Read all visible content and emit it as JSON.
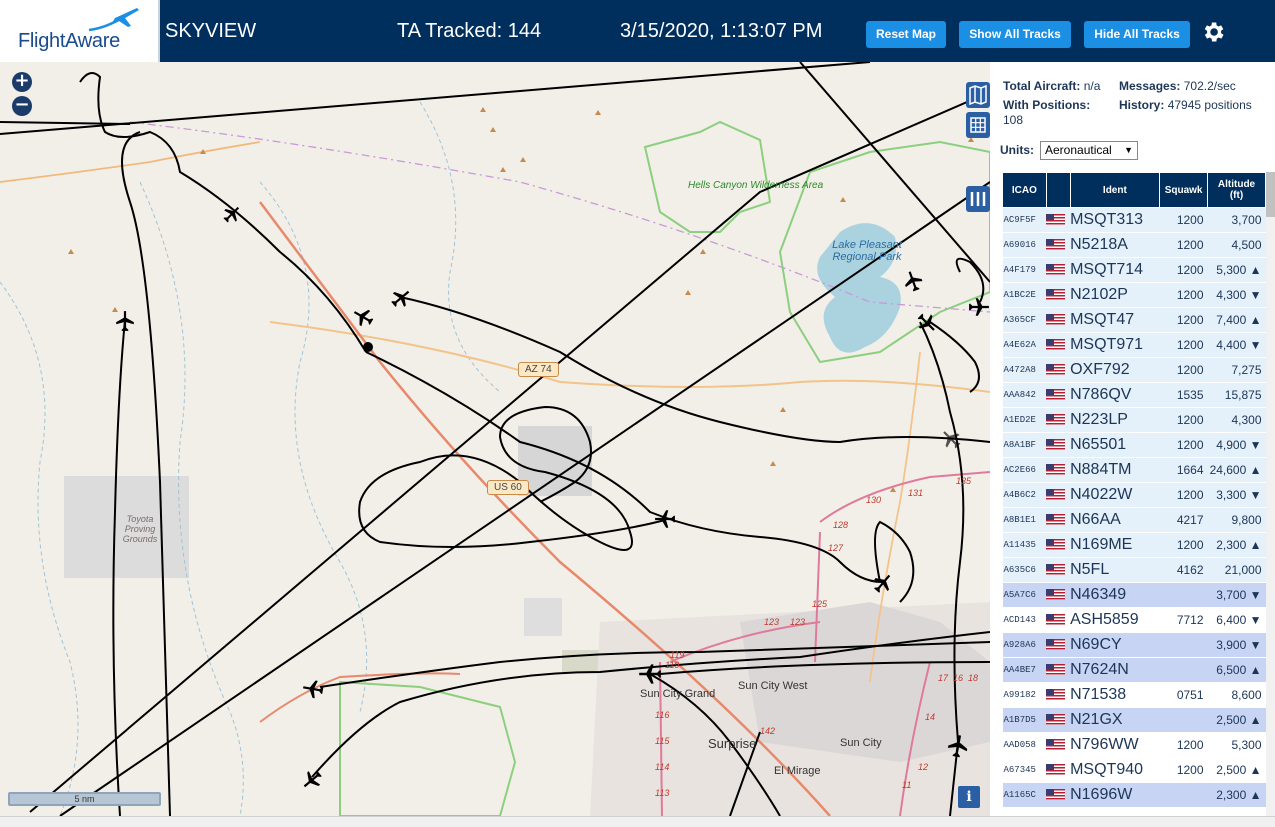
{
  "header": {
    "logo_text": "FlightAware",
    "app_title": "SKYVIEW",
    "tracked": "TA Tracked: 144",
    "datetime": "3/15/2020, 1:13:07 PM",
    "buttons": {
      "reset_map": "Reset Map",
      "show_all": "Show All Tracks",
      "hide_all": "Hide All Tracks"
    },
    "settings_icon": "gear-icon"
  },
  "colors": {
    "header_bg": "#002f5d",
    "button_bg": "#1a8fe3",
    "row_alt": "#e4f0fa",
    "row_selected": "#c8d4f4"
  },
  "map": {
    "zoom_in": "+",
    "zoom_out": "−",
    "scale_label": "5 nm",
    "info": "i",
    "labels": {
      "hells_canyon": "Hells Canyon Wilderness Area",
      "lake_pleasant": "Lake Pleasant Regional Park",
      "toyota": "Toyota Proving Grounds",
      "az74": "AZ 74",
      "us60": "US 60",
      "sun_city_grand": "Sun City Grand",
      "sun_city_west": "Sun City West",
      "surprise": "Surprise",
      "sun_city": "Sun City",
      "el_mirage": "El Mirage"
    },
    "road_numbers": [
      "130",
      "131",
      "135",
      "128",
      "127",
      "125",
      "123",
      "123",
      "119",
      "119",
      "142",
      "116",
      "115",
      "114",
      "113",
      "17",
      "16",
      "18",
      "14",
      "12",
      "11"
    ]
  },
  "sidebar": {
    "total_aircraft_label": "Total Aircraft:",
    "total_aircraft_value": "n/a",
    "messages_label": "Messages:",
    "messages_value": "702.2/sec",
    "with_positions_label": "With Positions:",
    "with_positions_value": "108",
    "history_label": "History:",
    "history_value": "47945 positions",
    "units_label": "Units:",
    "units_value": "Aeronautical",
    "columns": {
      "icao": "ICAO",
      "ident": "Ident",
      "squawk": "Squawk",
      "altitude": "Altitude (ft)"
    },
    "rows": [
      {
        "icao": "AC9F5F",
        "ident": "MSQT313",
        "squawk": "1200",
        "alt": "3,700",
        "style": "row-a"
      },
      {
        "icao": "A69016",
        "ident": "N5218A",
        "squawk": "1200",
        "alt": "4,500",
        "style": "row-a"
      },
      {
        "icao": "A4F179",
        "ident": "MSQT714",
        "squawk": "1200",
        "alt": "5,300 ▲",
        "style": "row-a"
      },
      {
        "icao": "A1BC2E",
        "ident": "N2102P",
        "squawk": "1200",
        "alt": "4,300 ▼",
        "style": "row-a"
      },
      {
        "icao": "A365CF",
        "ident": "MSQT47",
        "squawk": "1200",
        "alt": "7,400 ▲",
        "style": "row-a"
      },
      {
        "icao": "A4E62A",
        "ident": "MSQT971",
        "squawk": "1200",
        "alt": "4,400 ▼",
        "style": "row-a"
      },
      {
        "icao": "A472A8",
        "ident": "OXF792",
        "squawk": "1200",
        "alt": "7,275",
        "style": "row-a"
      },
      {
        "icao": "AAA842",
        "ident": "N786QV",
        "squawk": "1535",
        "alt": "15,875",
        "style": "row-a"
      },
      {
        "icao": "A1ED2E",
        "ident": "N223LP",
        "squawk": "1200",
        "alt": "4,300",
        "style": "row-a"
      },
      {
        "icao": "A8A1BF",
        "ident": "N65501",
        "squawk": "1200",
        "alt": "4,900 ▼",
        "style": "row-a"
      },
      {
        "icao": "AC2E66",
        "ident": "N884TM",
        "squawk": "1664",
        "alt": "24,600 ▲",
        "style": "row-a"
      },
      {
        "icao": "A4B6C2",
        "ident": "N4022W",
        "squawk": "1200",
        "alt": "3,300 ▼",
        "style": "row-a"
      },
      {
        "icao": "A8B1E1",
        "ident": "N66AA",
        "squawk": "4217",
        "alt": "9,800",
        "style": "row-a"
      },
      {
        "icao": "A11435",
        "ident": "N169ME",
        "squawk": "1200",
        "alt": "2,300 ▲",
        "style": "row-a"
      },
      {
        "icao": "A635C6",
        "ident": "N5FL",
        "squawk": "4162",
        "alt": "21,000",
        "style": "row-a"
      },
      {
        "icao": "A5A7C6",
        "ident": "N46349",
        "squawk": "",
        "alt": "3,700 ▼",
        "style": "row-sel"
      },
      {
        "icao": "ACD143",
        "ident": "ASH5859",
        "squawk": "7712",
        "alt": "6,400 ▼",
        "style": "row-b"
      },
      {
        "icao": "A928A6",
        "ident": "N69CY",
        "squawk": "",
        "alt": "3,900 ▼",
        "style": "row-sel"
      },
      {
        "icao": "AA4BE7",
        "ident": "N7624N",
        "squawk": "",
        "alt": "6,500 ▲",
        "style": "row-sel"
      },
      {
        "icao": "A99182",
        "ident": "N71538",
        "squawk": "0751",
        "alt": "8,600",
        "style": "row-b"
      },
      {
        "icao": "A1B7D5",
        "ident": "N21GX",
        "squawk": "",
        "alt": "2,500 ▲",
        "style": "row-sel"
      },
      {
        "icao": "AAD058",
        "ident": "N796WW",
        "squawk": "1200",
        "alt": "5,300",
        "style": "row-b"
      },
      {
        "icao": "A67345",
        "ident": "MSQT940",
        "squawk": "1200",
        "alt": "2,500 ▲",
        "style": "row-b"
      },
      {
        "icao": "A1165C",
        "ident": "N1696W",
        "squawk": "",
        "alt": "2,300 ▲",
        "style": "row-sel"
      }
    ]
  }
}
